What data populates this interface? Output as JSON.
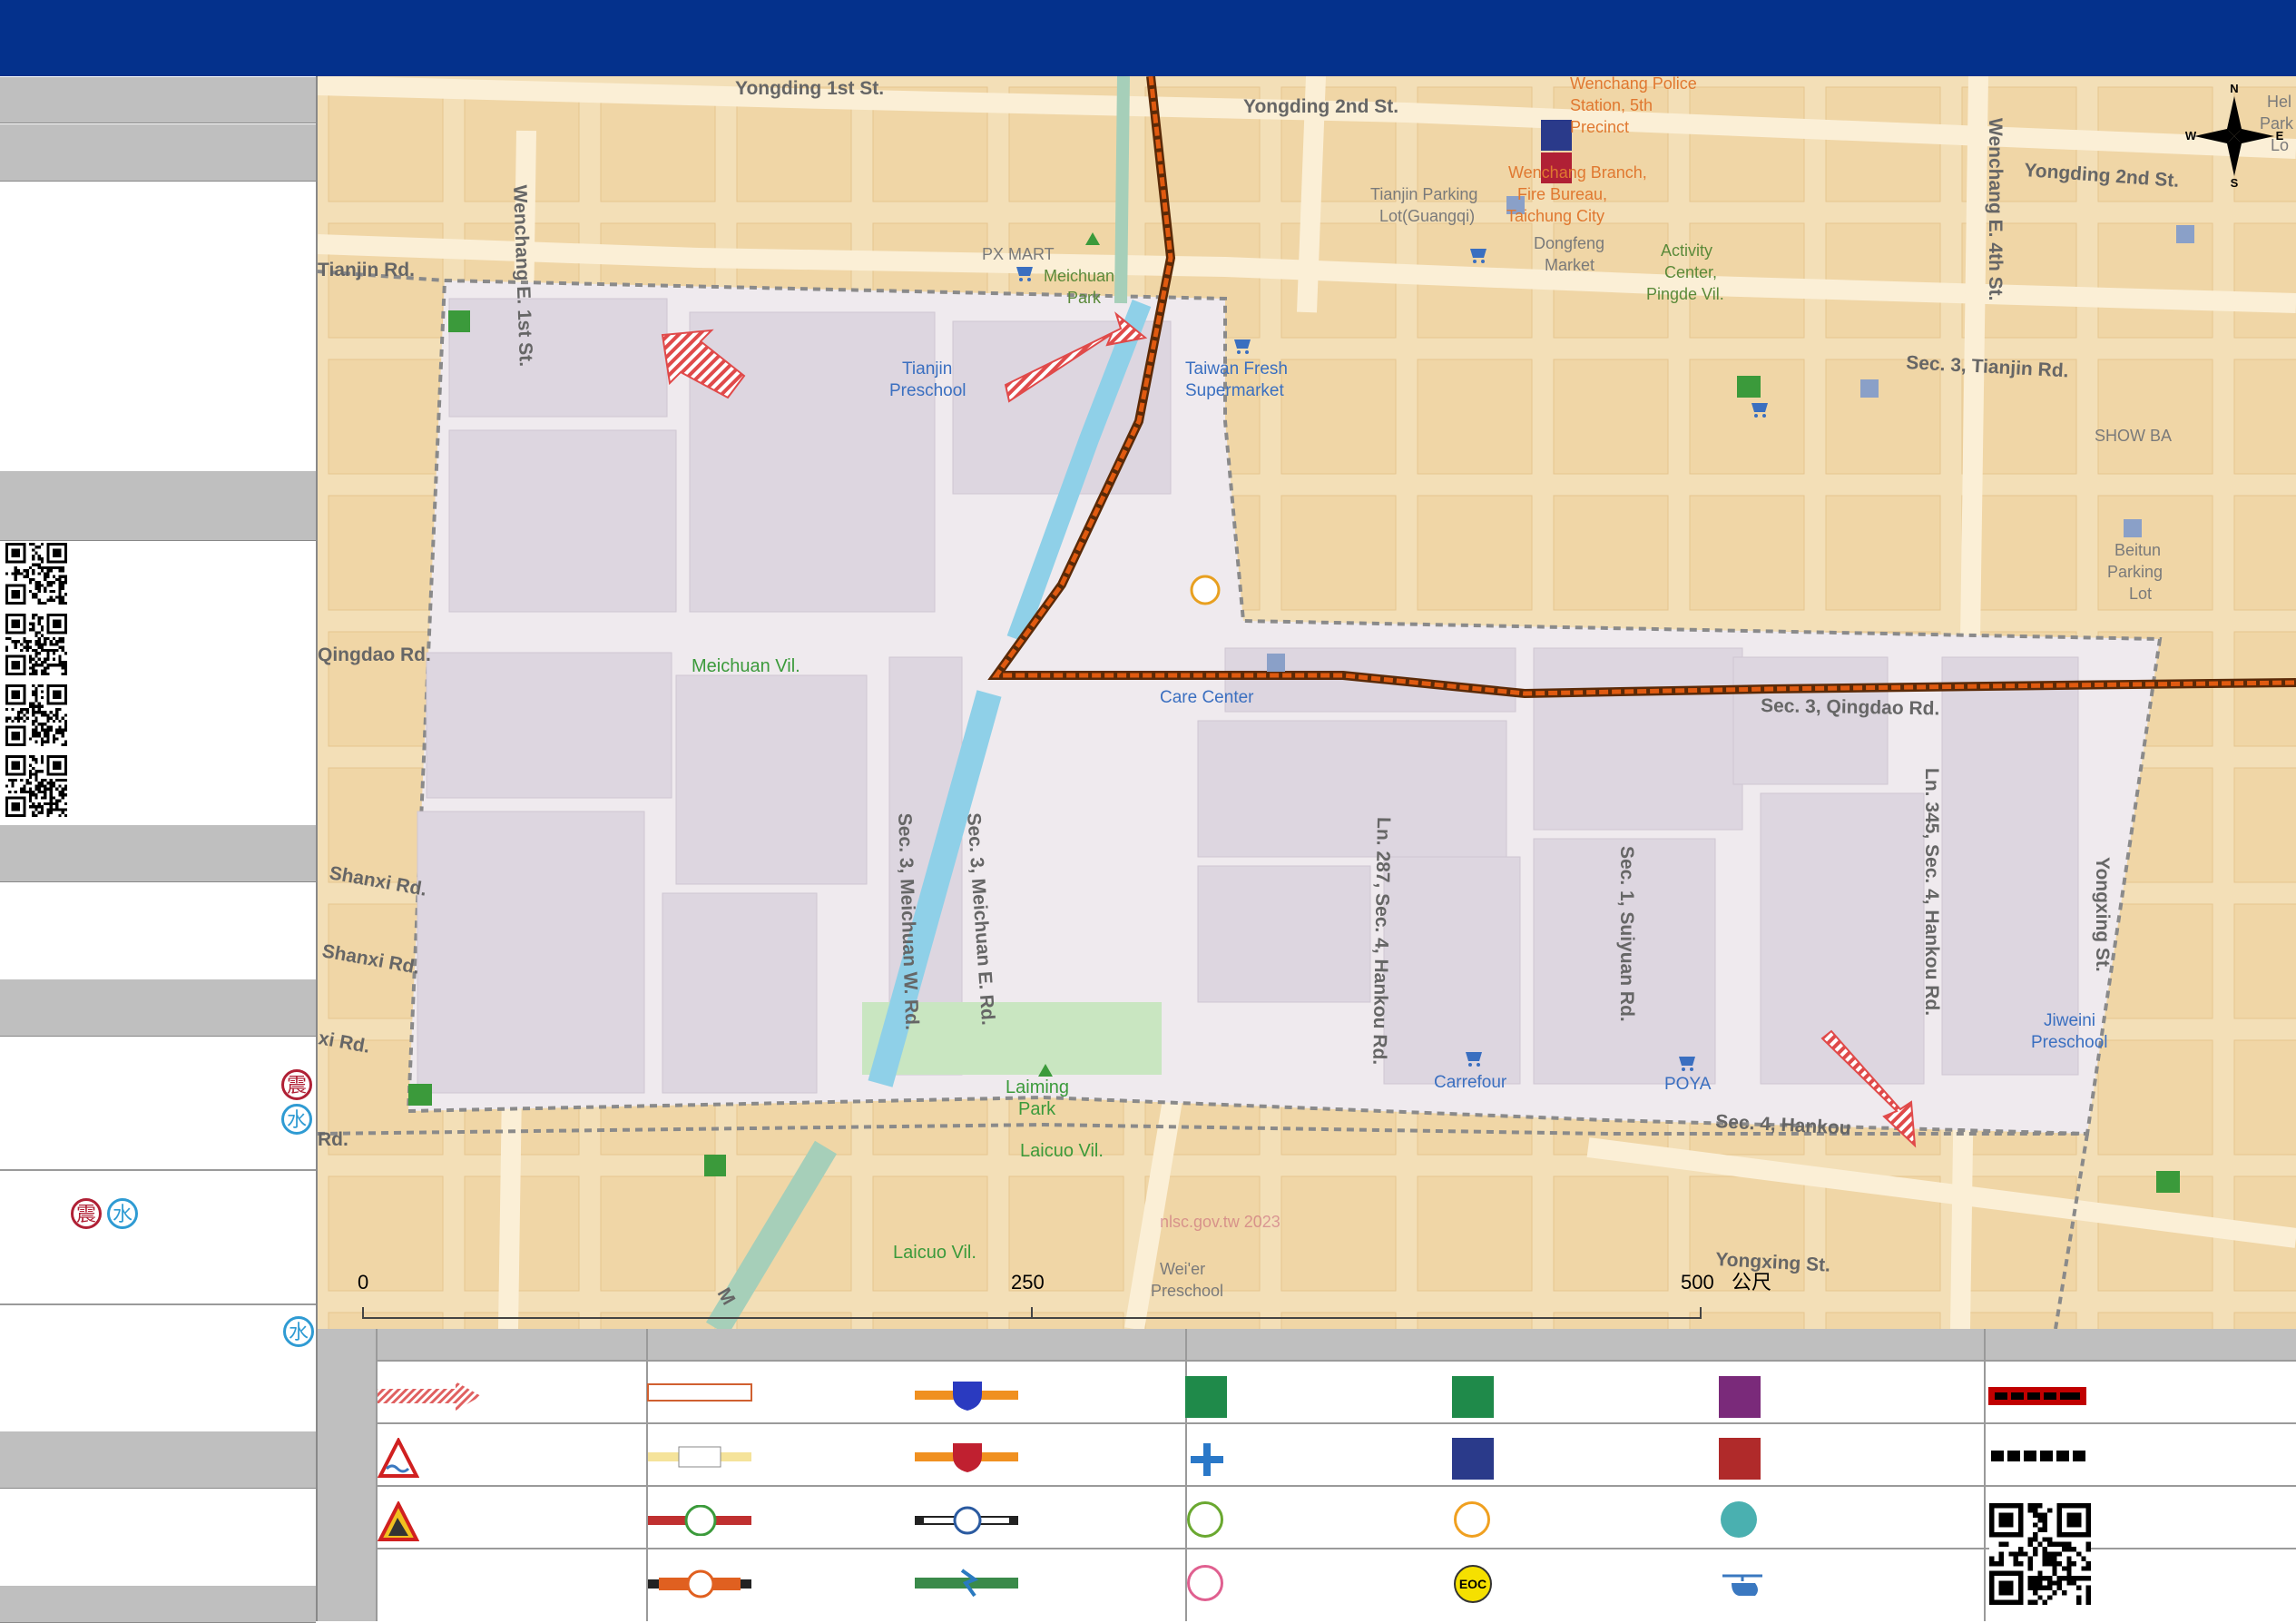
{
  "map": {
    "street_labels": {
      "yongding_1st": "Yongding 1st St.",
      "yongding_2nd_left": "Yongding 2nd St.",
      "yongding_2nd_right": "Yongding 2nd St.",
      "tianjin_left": "Tianjin Rd.",
      "tianjin_right": "Sec. 3, Tianjin Rd.",
      "wenchang_e1": "Wenchang E. 1st St.",
      "wenchang_e4": "Wenchang E. 4th St.",
      "qingdao_left": "Qingdao Rd.",
      "qingdao_right": "Sec. 3, Qingdao Rd.",
      "shanxi_1": "Shanxi Rd.",
      "shanxi_2": "Shanxi Rd.",
      "xi_rd": "xi Rd.",
      "meichuan_w": "Sec. 3, Meichuan W. Rd.",
      "meichuan_e": "Sec. 3, Meichuan E. Rd.",
      "hankou_287": "Ln. 287, Sec. 4, Hankou Rd.",
      "suiyuan": "Sec. 1, Suiyuan Rd.",
      "hankou_345": "Ln. 345, Sec. 4, Hankou Rd.",
      "hankou_sec4": "Sec. 4, Hankou",
      "yongxing": "Yongxing St.",
      "rd_fragment": "Rd.",
      "yongxing_vertical": "Yongxing St.",
      "m_fragment": "M"
    },
    "poi_labels": {
      "police_1": "Wenchang Police",
      "police_2": "Station, 5th",
      "police_3": "Precinct",
      "fire_1": "Wenchang Branch,",
      "fire_2": "Fire Bureau,",
      "fire_3": "Taichung City",
      "parking_tianjin_1": "Tianjin Parking",
      "parking_tianjin_2": "Lot(Guangqi)",
      "dongfeng_1": "Dongfeng",
      "dongfeng_2": "Market",
      "activity_1": "Activity",
      "activity_2": "Center,",
      "activity_3": "Pingde Vil.",
      "pxmart": "PX MART",
      "meichuan_park_1": "Meichuan",
      "meichuan_park_2": "Park",
      "tianjin_pre_1": "Tianjin",
      "tianjin_pre_2": "Preschool",
      "taiwan_fresh_1": "Taiwan Fresh",
      "taiwan_fresh_2": "Supermarket",
      "showba": "SHOW BA",
      "beitun_1": "Beitun",
      "beitun_2": "Parking",
      "beitun_3": "Lot",
      "meichuan_vil": "Meichuan Vil.",
      "care_center": "Care Center",
      "laiming_1": "Laiming",
      "laiming_2": "Park",
      "carrefour": "Carrefour",
      "poya": "POYA",
      "jiweini_1": "Jiweini",
      "jiweini_2": "Preschool",
      "laicuo_1": "Laicuo Vil.",
      "laicuo_2": "Laicuo Vil.",
      "weier_1": "Wei'er",
      "weier_2": "Preschool",
      "help_1": "Hel",
      "help_2": "Park",
      "help_3": "Lo",
      "watermark": "nlsc.gov.tw 2023"
    },
    "compass": {
      "n": "N",
      "s": "S",
      "e": "E",
      "w": "W"
    },
    "scale": {
      "t0": "0",
      "t250": "250",
      "t500": "500",
      "unit": "公尺"
    }
  },
  "sidebar": {
    "hazard_eq": "震",
    "hazard_water": "水"
  },
  "icons": [
    "arrow-icon",
    "triangle-warning-icon",
    "landslide-warning-icon",
    "route-icon",
    "shield-icon",
    "evacuation-icon",
    "aid-station-icon",
    "medical-icon",
    "police-icon",
    "fire-icon",
    "accessible-icon",
    "elderly-icon",
    "child-care-icon",
    "eoc-icon",
    "helicopter-icon",
    "qr-code-icon"
  ],
  "legend": {
    "eoc": "EOC"
  },
  "colors": {
    "header": "#04318c",
    "evac_route": "#e05a10",
    "river": "#8fd0e8",
    "arrow": "#e04a4a",
    "boundary": "#8a8a8a",
    "park_text": "#3b9a3b",
    "poi_blue": "#3a6fc0"
  }
}
